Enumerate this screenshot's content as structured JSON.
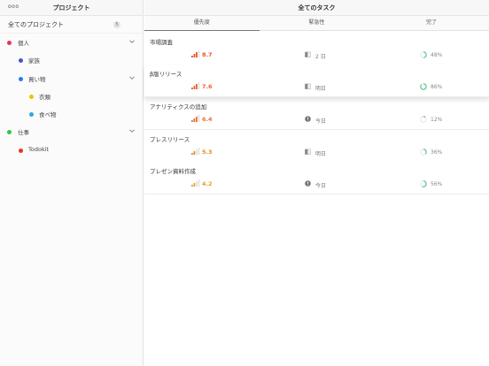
{
  "sidebar": {
    "more_label": "ooo",
    "title": "プロジェクト",
    "all_projects": {
      "label": "全てのプロジェクト",
      "count": "5"
    },
    "projects": [
      {
        "label": "個人",
        "color": "#e8355a",
        "level": 0,
        "expanded": true
      },
      {
        "label": "家族",
        "color": "#4a4fd1",
        "level": 1,
        "expanded": false
      },
      {
        "label": "買い物",
        "color": "#2a7be8",
        "level": 1,
        "expanded": true
      },
      {
        "label": "衣類",
        "color": "#f2c000",
        "level": 2,
        "expanded": false
      },
      {
        "label": "食べ物",
        "color": "#2aa6e0",
        "level": 2,
        "expanded": false
      },
      {
        "label": "仕事",
        "color": "#35c24a",
        "level": 0,
        "expanded": true
      },
      {
        "label": "Todokit",
        "color": "#e8352a",
        "level": 1,
        "expanded": false
      }
    ]
  },
  "main": {
    "title": "全てのタスク",
    "tabs": [
      {
        "label": "優先度",
        "active": true
      },
      {
        "label": "緊急性",
        "active": false
      },
      {
        "label": "完了",
        "active": false
      }
    ]
  },
  "tasks": [
    {
      "name": "市場調査",
      "priority": "8.7",
      "priority_color": "#e8542a",
      "urgency": "2 日",
      "urgency_icon": "calendar-icon",
      "completion": "48%",
      "completion_fraction": 0.48
    },
    {
      "name": "β版リリース",
      "priority": "7.6",
      "priority_color": "#e8642a",
      "urgency": "明日",
      "urgency_icon": "calendar-icon",
      "completion": "86%",
      "completion_fraction": 0.86
    },
    {
      "name": "アナリティクスの追加",
      "priority": "6.4",
      "priority_color": "#ea7030",
      "urgency": "今日",
      "urgency_icon": "alert-icon",
      "completion": "12%",
      "completion_fraction": 0.12
    },
    {
      "name": "プレスリリース",
      "priority": "5.3",
      "priority_color": "#e88a20",
      "urgency": "明日",
      "urgency_icon": "calendar-icon",
      "completion": "36%",
      "completion_fraction": 0.36
    },
    {
      "name": "プレゼン資料作成",
      "priority": "4.2",
      "priority_color": "#e8a020",
      "urgency": "今日",
      "urgency_icon": "alert-icon",
      "completion": "56%",
      "completion_fraction": 0.56
    }
  ],
  "colors": {
    "progress": "#3ac37a",
    "progress_track": "#e5e5e5",
    "priority_bar_empty": "#e3e3e3"
  }
}
